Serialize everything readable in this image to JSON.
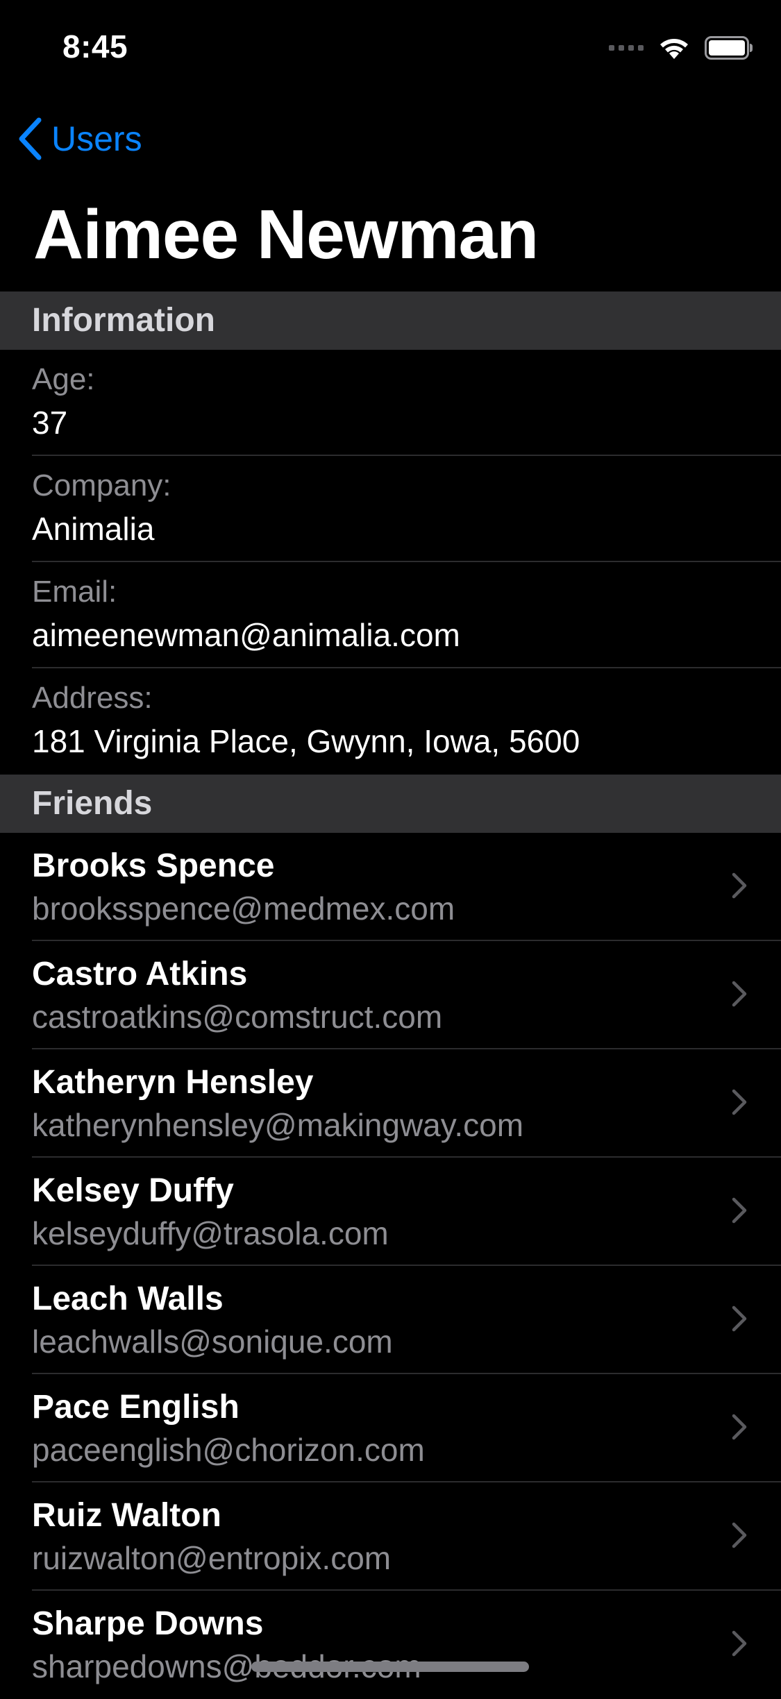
{
  "status_bar": {
    "time": "8:45"
  },
  "nav": {
    "back_label": "Users",
    "title": "Aimee Newman"
  },
  "colors": {
    "background": "#000000",
    "accent": "#0a84ff",
    "section_header_bg": "#313133",
    "secondary_text": "#8e8e93"
  },
  "information": {
    "header": "Information",
    "rows": [
      {
        "label": "Age:",
        "value": "37"
      },
      {
        "label": "Company:",
        "value": "Animalia"
      },
      {
        "label": "Email:",
        "value": "aimeenewman@animalia.com"
      },
      {
        "label": "Address:",
        "value": "181 Virginia Place, Gwynn, Iowa, 5600"
      }
    ]
  },
  "friends": {
    "header": "Friends",
    "items": [
      {
        "name": "Brooks Spence",
        "email": "brooksspence@medmex.com"
      },
      {
        "name": "Castro Atkins",
        "email": "castroatkins@comstruct.com"
      },
      {
        "name": "Katheryn Hensley",
        "email": "katherynhensley@makingway.com"
      },
      {
        "name": "Kelsey Duffy",
        "email": "kelseyduffy@trasola.com"
      },
      {
        "name": "Leach Walls",
        "email": "leachwalls@sonique.com"
      },
      {
        "name": "Pace English",
        "email": "paceenglish@chorizon.com"
      },
      {
        "name": "Ruiz Walton",
        "email": "ruizwalton@entropix.com"
      },
      {
        "name": "Sharpe Downs",
        "email": "sharpedowns@beddor.com"
      }
    ]
  },
  "icons": {
    "back": "chevron-left-icon",
    "row_disclosure": "chevron-right-icon",
    "wifi": "wifi-icon",
    "battery": "battery-icon"
  }
}
